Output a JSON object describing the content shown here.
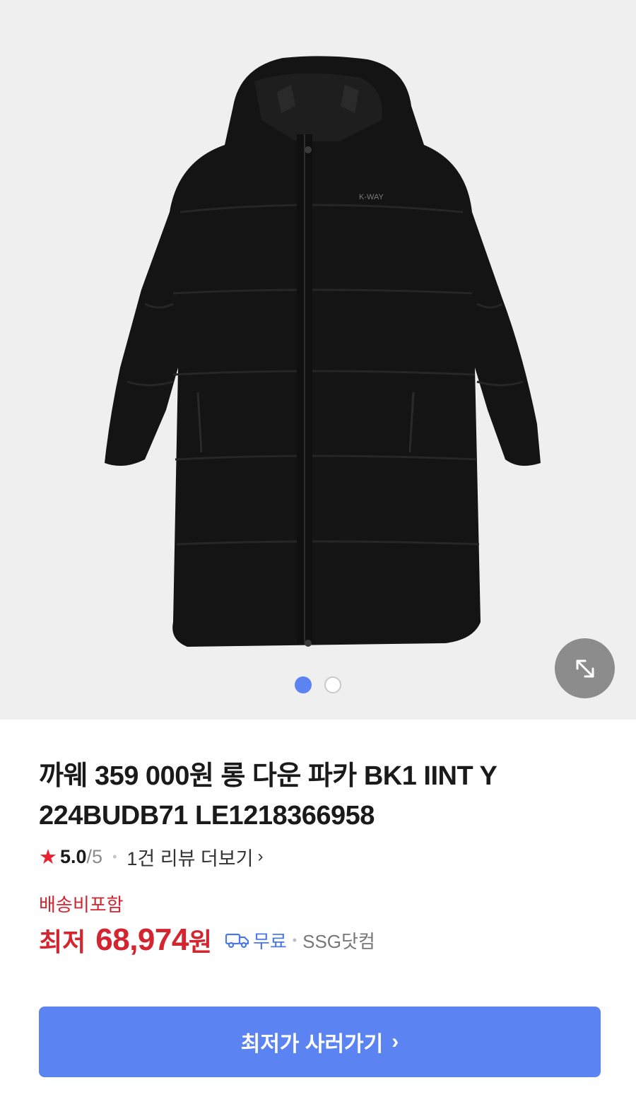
{
  "product": {
    "title": "까웨 359 000원 롱 다운 파카 BK1 IINT Y 224BUDB71 LE1218366958",
    "rating": {
      "star_icon": "star-icon",
      "score": "5.0",
      "max": "/5",
      "separator": "•",
      "review_link": "1건 리뷰 더보기"
    },
    "image": {
      "logo_text": "K-WAY",
      "slide_count": 2,
      "active_slide": 1
    }
  },
  "pricing": {
    "shipping_note": "배송비포함",
    "prefix": "최저",
    "amount": "68,974",
    "unit": "원",
    "delivery": "무료",
    "separator": "•",
    "seller": "SSG닷컴"
  },
  "buy_button": {
    "label": "최저가 사러가기"
  },
  "colors": {
    "accent": "#5b84f2",
    "price": "#d4242f",
    "star": "#e8222e"
  }
}
